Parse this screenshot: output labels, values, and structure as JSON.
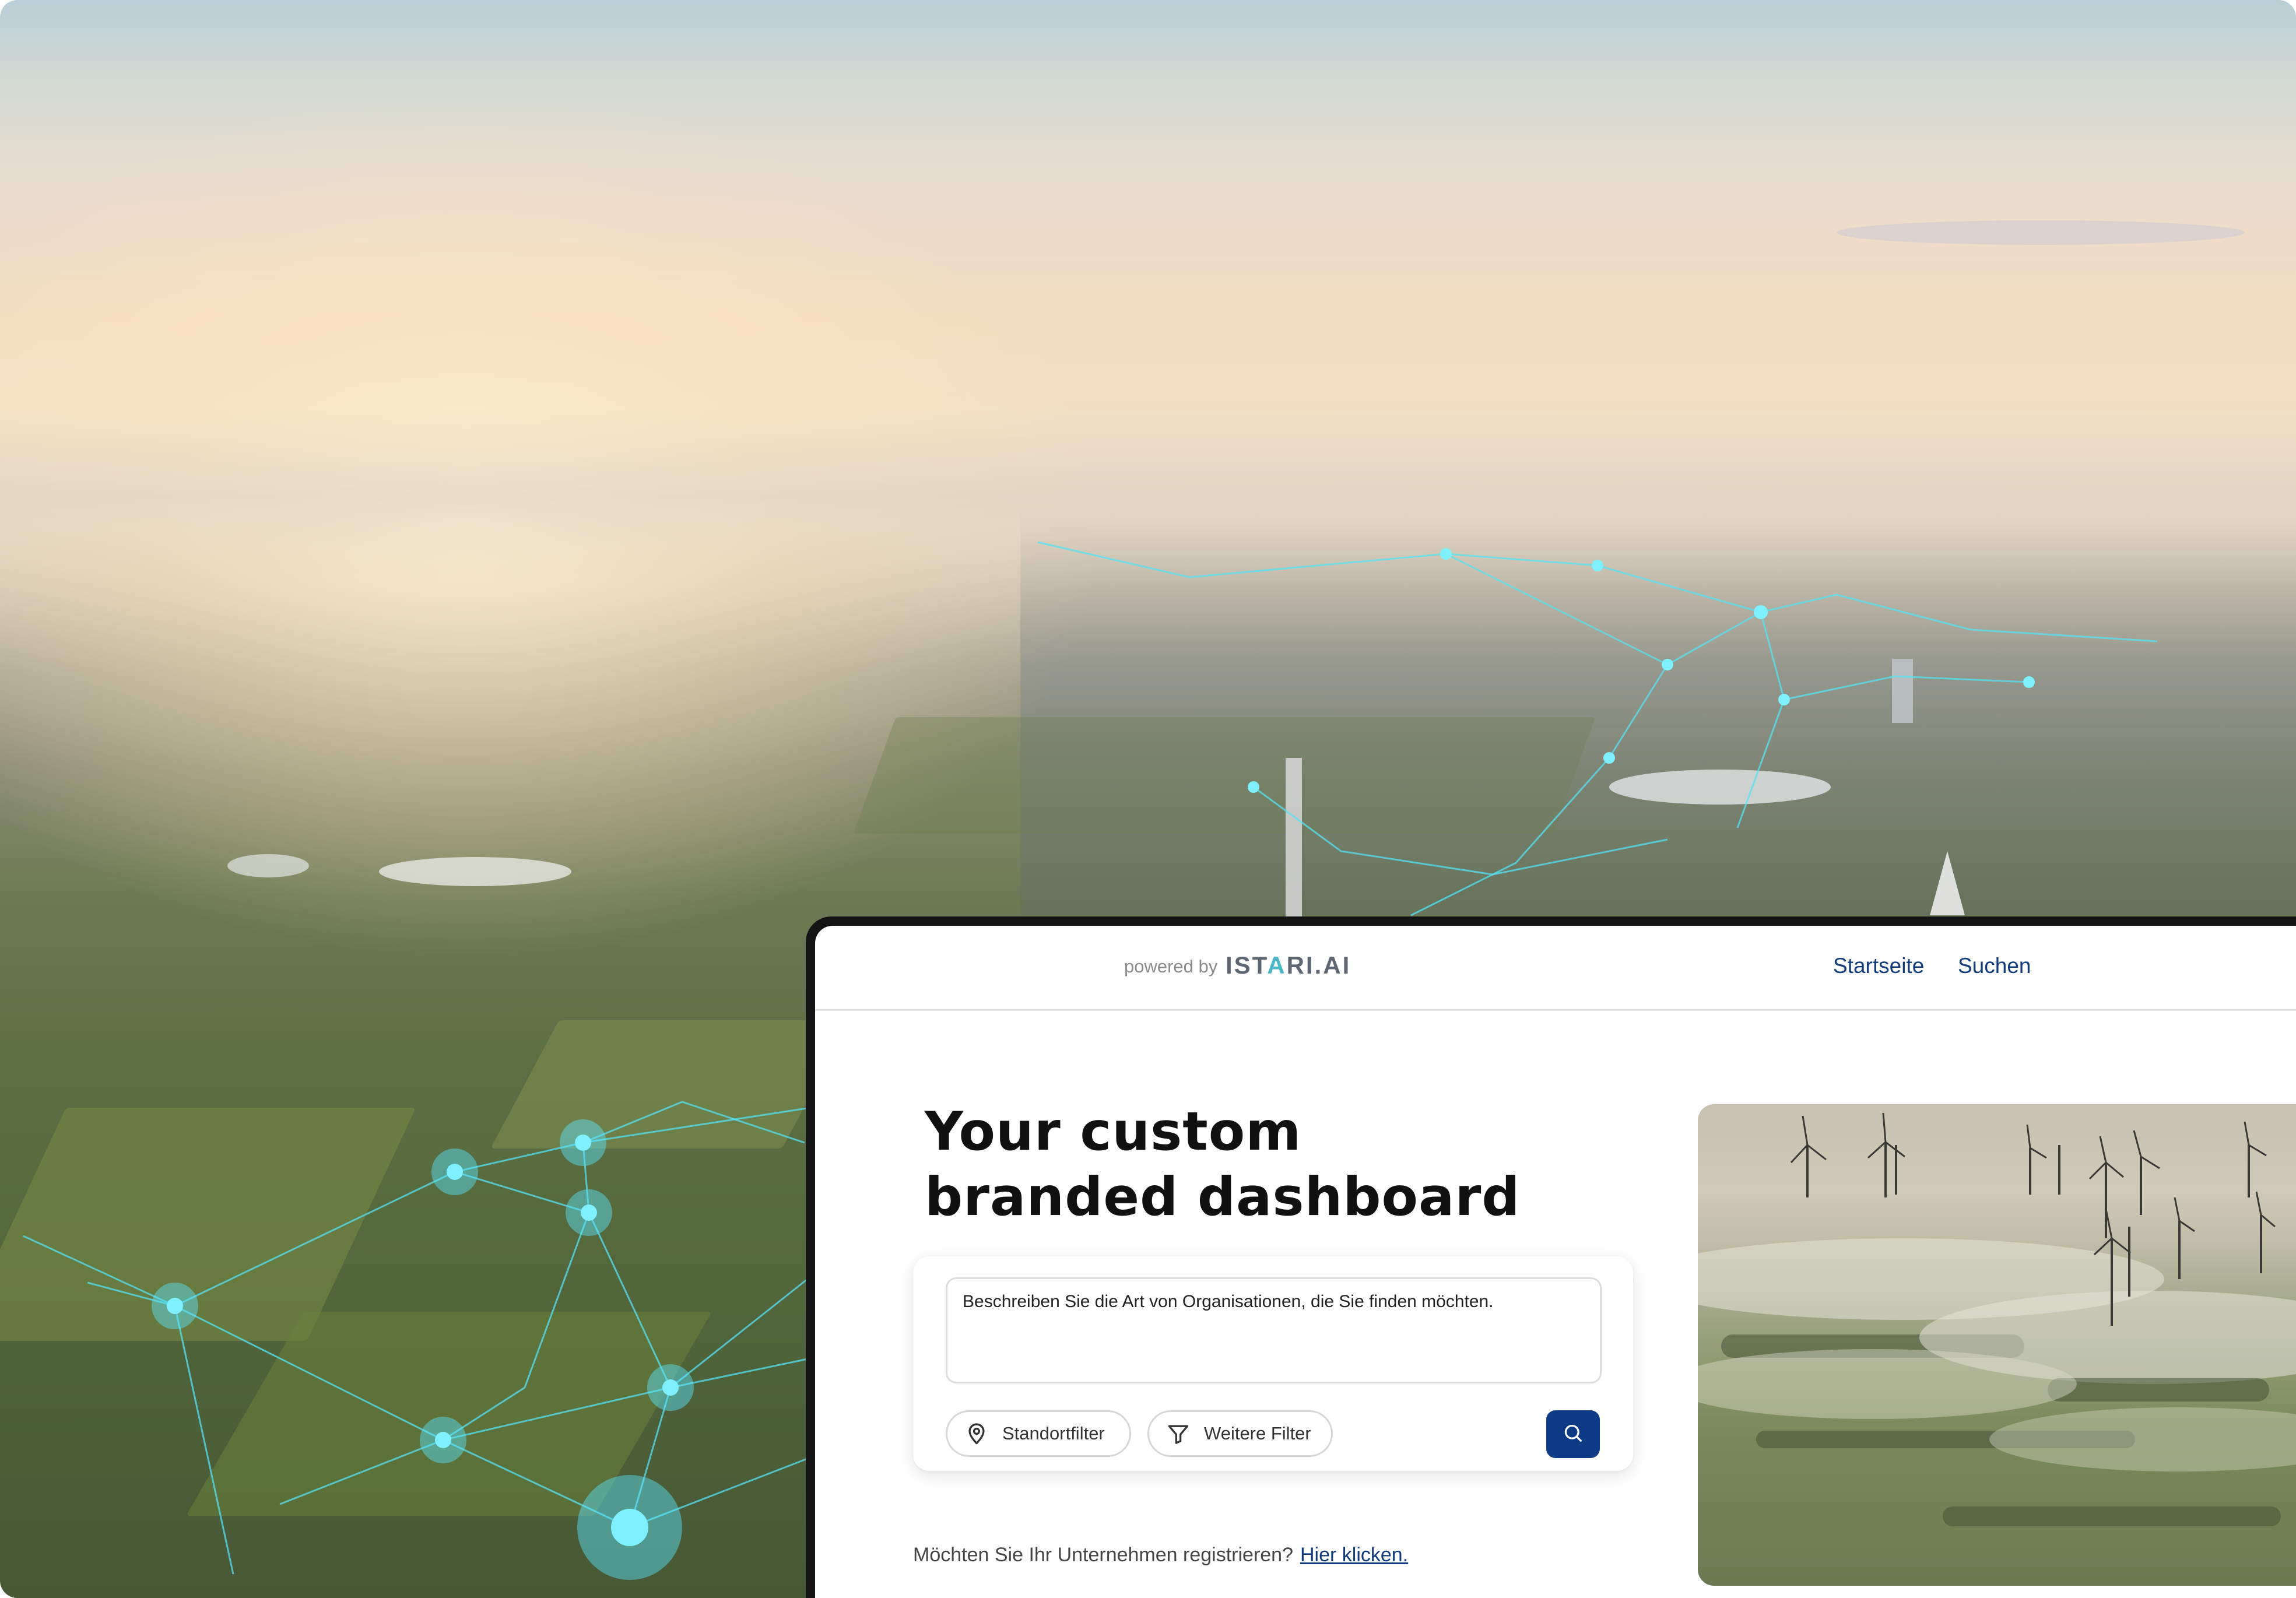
{
  "colors": {
    "primary": "#0c3a85",
    "nav_link": "#103c7d",
    "brand_accent": "#49b8c6",
    "network_glow": "#55e2f5"
  },
  "brand": {
    "powered_by": "powered by",
    "logo_prefix": "IST",
    "logo_accent": "A",
    "logo_suffix": "RI.AI"
  },
  "nav": {
    "home": "Startseite",
    "search": "Suchen"
  },
  "headline": {
    "line1": "Your custom",
    "line2": "branded dashboard"
  },
  "search": {
    "placeholder": "Beschreiben Sie die Art von Organisationen, die Sie finden möchten.",
    "location_filter": "Standortfilter",
    "more_filters": "Weitere Filter",
    "submit_icon": "search-icon"
  },
  "register": {
    "question": "Möchten Sie Ihr Unternehmen registrieren?",
    "link_text": "Hier klicken."
  },
  "icons": {
    "location_chip": "map-pin-icon",
    "more_chip": "funnel-icon"
  }
}
